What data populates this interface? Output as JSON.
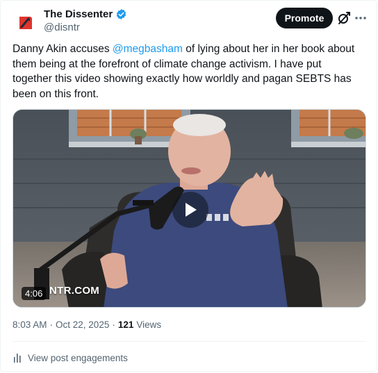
{
  "author": {
    "display_name": "The Dissenter",
    "handle": "@disntr",
    "avatar_icon": "dissenter-logo-icon",
    "verified_icon": "verified-badge-icon",
    "verified_color": "#1d9bf0"
  },
  "header": {
    "promote_label": "Promote",
    "grok_icon": "grok-icon",
    "more_icon": "more-options-icon"
  },
  "tweet": {
    "text_before": "Danny Akin accuses ",
    "mention": "@megbasham",
    "text_after": " of lying about her in her book about them being at the forefront of climate change activism. I have put together this video showing exactly how worldly and pagan SEBTS has been on this front."
  },
  "media": {
    "duration": "4:06",
    "watermark": "NTR.COM",
    "play_icon": "play-icon"
  },
  "meta": {
    "time": "8:03 AM",
    "separator": "·",
    "date": "Oct 22, 2025",
    "views_count": "121",
    "views_label": "Views"
  },
  "footer": {
    "engagements_label": "View post engagements",
    "engagements_icon": "analytics-icon"
  },
  "colors": {
    "accent": "#1d9bf0",
    "text": "#0f1419",
    "secondary": "#536471",
    "promote_bg": "#0f1419",
    "logo_red": "#e0342d"
  }
}
